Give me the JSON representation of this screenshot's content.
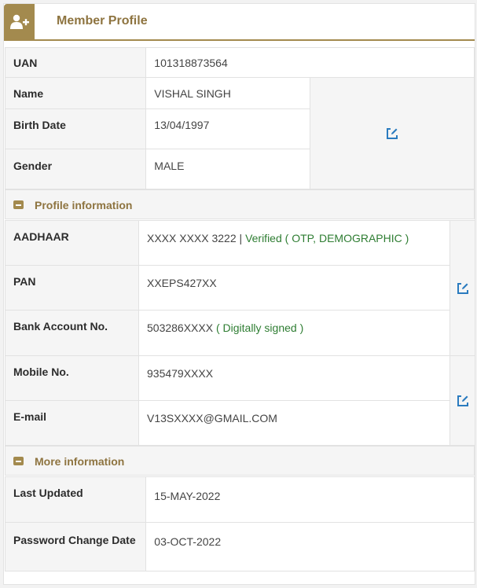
{
  "header": {
    "title": "Member Profile",
    "icon": "add-user-icon"
  },
  "basic": {
    "uan": {
      "label": "UAN",
      "value": "101318873564"
    },
    "name": {
      "label": "Name",
      "value": "VISHAL SINGH"
    },
    "birth_date": {
      "label": "Birth Date",
      "value": "13/04/1997"
    },
    "gender": {
      "label": "Gender",
      "value": "MALE"
    }
  },
  "profile_section": {
    "title": "Profile information",
    "aadhaar": {
      "label": "AADHAAR",
      "value": "XXXX XXXX 3222",
      "separator": " | ",
      "status": "Verified ( OTP, DEMOGRAPHIC )"
    },
    "pan": {
      "label": "PAN",
      "value": "XXEPS427XX"
    },
    "bank": {
      "label": "Bank Account No.",
      "value": "503286XXXX",
      "status": " ( Digitally signed )"
    },
    "mobile": {
      "label": "Mobile No.",
      "value": "935479XXXX"
    },
    "email": {
      "label": "E-mail",
      "value": "V13SXXXX@GMAIL.COM"
    }
  },
  "more_section": {
    "title": "More information",
    "last_updated": {
      "label": "Last Updated",
      "value": "15-MAY-2022"
    },
    "password_change": {
      "label": "Password Change Date",
      "value": "03-OCT-2022"
    }
  },
  "colors": {
    "accent": "#a38a4e",
    "title": "#8e7440",
    "status_green": "#2e7d32",
    "edit_icon": "#2a7bbf"
  }
}
